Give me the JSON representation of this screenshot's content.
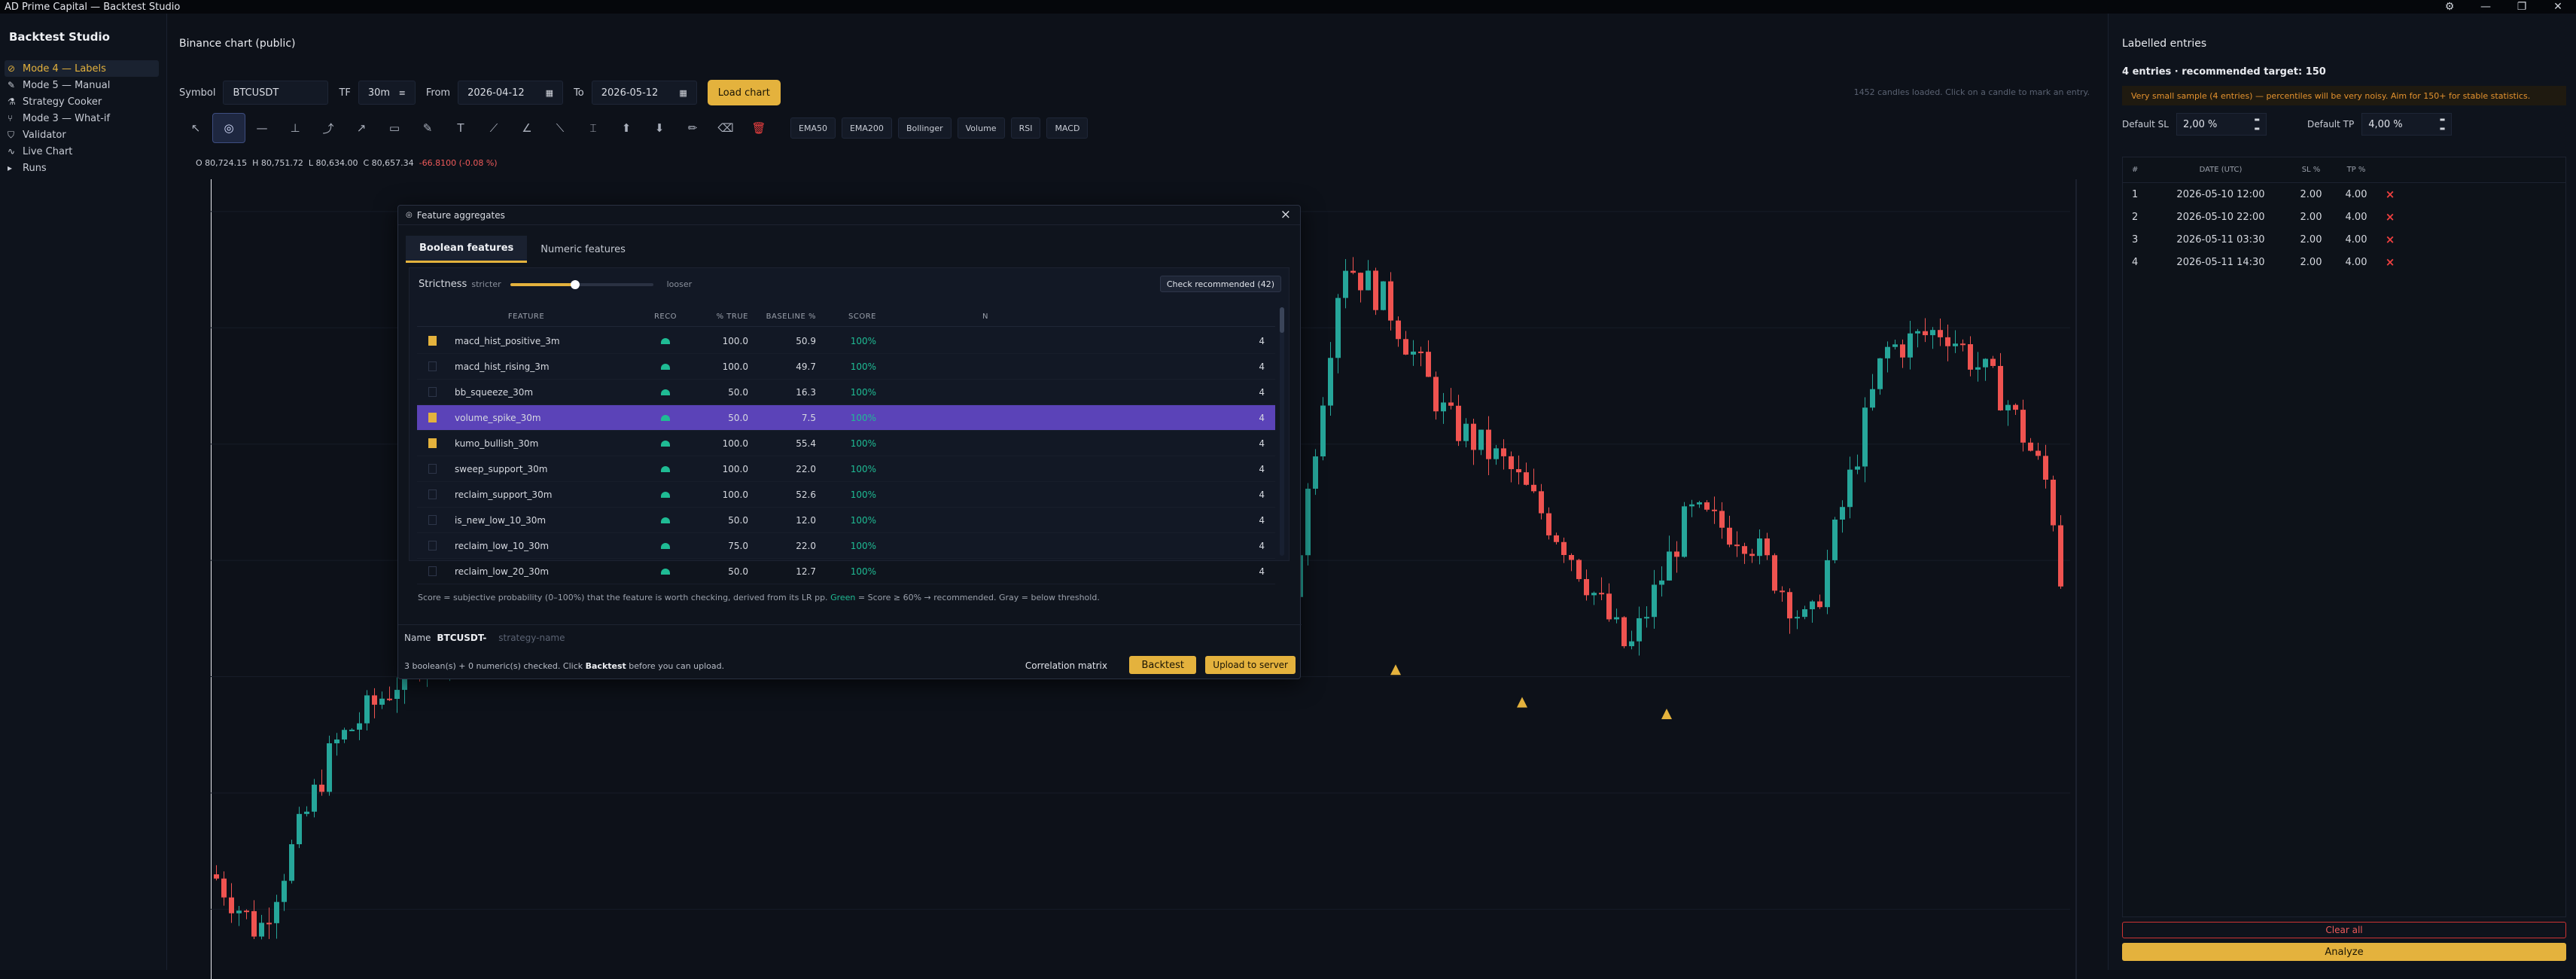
{
  "window": {
    "title": "AD Prime Capital — Backtest Studio"
  },
  "sidebar": {
    "brand": "Backtest Studio",
    "items": [
      {
        "label": "Mode 4 — Labels",
        "icon": "tag-icon",
        "active": true
      },
      {
        "label": "Mode 5 — Manual",
        "icon": "pencil-icon",
        "active": false
      },
      {
        "label": "Strategy Cooker",
        "icon": "flask-icon",
        "active": false
      },
      {
        "label": "Mode 3 — What-if",
        "icon": "branch-icon",
        "active": false
      },
      {
        "label": "Validator",
        "icon": "shield-icon",
        "active": false
      },
      {
        "label": "Live Chart",
        "icon": "line-chart-icon",
        "active": false
      },
      {
        "label": "Runs",
        "icon": "runs-icon",
        "active": false
      }
    ]
  },
  "main": {
    "title": "Binance chart (public)",
    "symbol_label": "Symbol",
    "symbol_value": "BTCUSDT",
    "tf_label": "TF",
    "tf_value": "30m",
    "from_label": "From",
    "from_value": "2026-04-12",
    "to_label": "To",
    "to_value": "2026-05-12",
    "load_label": "Load chart",
    "hint": "1452 candles loaded. Click on a candle to mark an entry.",
    "indicators": [
      "EMA50",
      "EMA200",
      "Bollinger",
      "Volume",
      "RSI",
      "MACD"
    ],
    "ohlc": {
      "o": "80,724.15",
      "h": "80,751.72",
      "l": "80,634.00",
      "c": "80,657.34",
      "chg": "-66.8100 (-0.08 %)"
    }
  },
  "chart_data": {
    "type": "candlestick",
    "ylim": [
      79200,
      82600
    ],
    "y_ticks": [
      "82500",
      "82000",
      "81500",
      "81000",
      "80500",
      "80000",
      "79500"
    ],
    "grid": true,
    "colors": {
      "up": "#26a69a",
      "down": "#ef5350",
      "marker": "#e4b23d"
    }
  },
  "modal": {
    "title": "Feature aggregates",
    "tabs": [
      "Boolean features",
      "Numeric features"
    ],
    "strictness_label": "Strictness",
    "stricter": "stricter",
    "looser": "looser",
    "check_recommended": "Check recommended (42)",
    "columns": {
      "feature": "FEATURE",
      "reco": "RECO",
      "true": "% TRUE",
      "baseline": "BASELINE %",
      "score": "SCORE",
      "n": "N"
    },
    "rows": [
      {
        "feature": "macd_hist_positive_3m",
        "checked": true,
        "true": "100.0",
        "baseline": "50.9",
        "score": "100%",
        "n": "4",
        "selected": false
      },
      {
        "feature": "macd_hist_rising_3m",
        "checked": false,
        "true": "100.0",
        "baseline": "49.7",
        "score": "100%",
        "n": "4",
        "selected": false
      },
      {
        "feature": "bb_squeeze_30m",
        "checked": false,
        "true": "50.0",
        "baseline": "16.3",
        "score": "100%",
        "n": "4",
        "selected": false
      },
      {
        "feature": "volume_spike_30m",
        "checked": true,
        "true": "50.0",
        "baseline": "7.5",
        "score": "100%",
        "n": "4",
        "selected": true
      },
      {
        "feature": "kumo_bullish_30m",
        "checked": true,
        "true": "100.0",
        "baseline": "55.4",
        "score": "100%",
        "n": "4",
        "selected": false
      },
      {
        "feature": "sweep_support_30m",
        "checked": false,
        "true": "100.0",
        "baseline": "22.0",
        "score": "100%",
        "n": "4",
        "selected": false
      },
      {
        "feature": "reclaim_support_30m",
        "checked": false,
        "true": "100.0",
        "baseline": "52.6",
        "score": "100%",
        "n": "4",
        "selected": false
      },
      {
        "feature": "is_new_low_10_30m",
        "checked": false,
        "true": "50.0",
        "baseline": "12.0",
        "score": "100%",
        "n": "4",
        "selected": false
      },
      {
        "feature": "reclaim_low_10_30m",
        "checked": false,
        "true": "75.0",
        "baseline": "22.0",
        "score": "100%",
        "n": "4",
        "selected": false
      },
      {
        "feature": "reclaim_low_20_30m",
        "checked": false,
        "true": "50.0",
        "baseline": "12.7",
        "score": "100%",
        "n": "4",
        "selected": false
      }
    ],
    "note_pre": "Score = subjective probability (0–100%) that the feature is worth checking, derived from its LR pp.",
    "note_green": "Green",
    "note_post": "= Score ≥ 60% → recommended. Gray = below threshold.",
    "name_label": "Name",
    "name_value": "BTCUSDT-",
    "name_placeholder": "strategy-name",
    "status_pre": "3 boolean(s) + 0 numeric(s) checked. Click",
    "status_bold": "Backtest",
    "status_post": "before you can upload.",
    "correlation": "Correlation matrix",
    "backtest": "Backtest",
    "upload": "Upload to server"
  },
  "right": {
    "title": "Labelled entries",
    "summary": "4 entries · recommended target: 150",
    "warning": "Very small sample (4 entries) — percentiles will be very noisy. Aim for 150+ for stable statistics.",
    "sl_label": "Default SL",
    "sl_value": "2,00 %",
    "tp_label": "Default TP",
    "tp_value": "4,00 %",
    "columns": {
      "n": "#",
      "date": "DATE (UTC)",
      "sl": "SL %",
      "tp": "TP %"
    },
    "entries": [
      {
        "n": "1",
        "date": "2026-05-10 12:00",
        "sl": "2.00",
        "tp": "4.00"
      },
      {
        "n": "2",
        "date": "2026-05-10 22:00",
        "sl": "2.00",
        "tp": "4.00"
      },
      {
        "n": "3",
        "date": "2026-05-11 03:30",
        "sl": "2.00",
        "tp": "4.00"
      },
      {
        "n": "4",
        "date": "2026-05-11 14:30",
        "sl": "2.00",
        "tp": "4.00"
      }
    ],
    "clear": "Clear all",
    "analyze": "Analyze"
  }
}
